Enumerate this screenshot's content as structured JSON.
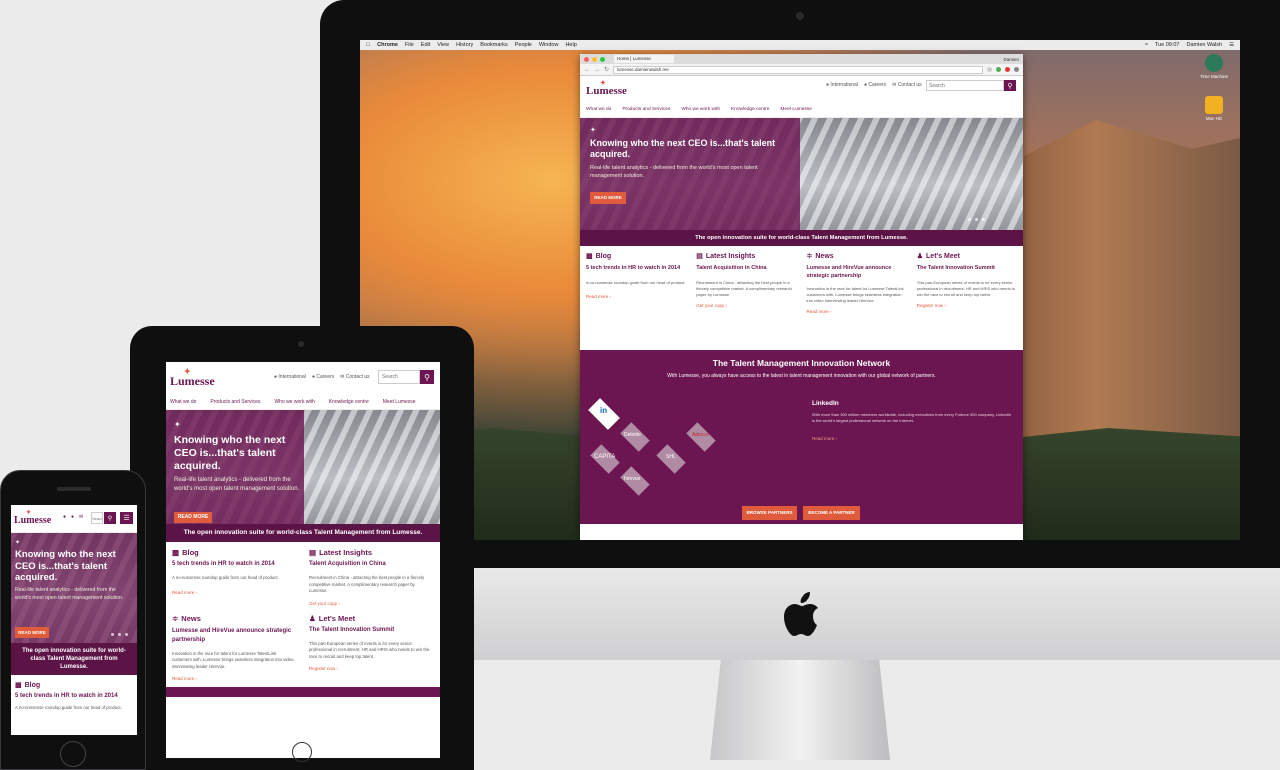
{
  "site": {
    "logo": "Lumesse",
    "utility": {
      "international": "International",
      "careers": "Careers",
      "contact": "Contact us"
    },
    "search_placeholder": "Search",
    "nav": [
      "What we do",
      "Products and Services",
      "Who we work with",
      "Knowledge centre",
      "Meet Lumesse"
    ],
    "hero": {
      "title": "Knowing who the next CEO is...that's talent acquired.",
      "subtitle": "Real-life talent analytics - delivered from the world's most open talent management solution.",
      "cta": "READ MORE"
    },
    "tagline": "The open innovation suite for world-class Talent Management from Lumesse.",
    "columns": [
      {
        "heading": "Blog",
        "title": "5 tech trends in HR to watch in 2014",
        "text": "A no-nonsense roundup guide from our head of product.",
        "link": "Read more ›"
      },
      {
        "heading": "Latest Insights",
        "title": "Talent Acquisition in China",
        "text": "Recruitment in China - attracting the best people in a fiercely competitive market. A complimentary research paper by Lumesse.",
        "link": "Get your copy ›"
      },
      {
        "heading": "News",
        "title": "Lumesse and HireVue announce strategic partnership",
        "text": "Innovation in the race for talent for Lumesse TalentLink customers with, Lumesse brings seamless integration into video interviewing leader HireVue.",
        "link": "Read more ›"
      },
      {
        "heading": "Let's Meet",
        "title": "The Talent Innovation Summit",
        "text": "This pan-European series of events is for every senior professional in recruitment, HR and HRIS who needs to win the race to recruit and keep top talent.",
        "link": "Register now ›"
      }
    ],
    "network": {
      "title": "The Talent Management Innovation Network",
      "intro": "With Lumesse, you always have access to the latest in talent management innovation with our global network of partners.",
      "partners": [
        "in",
        "Deloitte",
        "Adecco",
        "CAPITA",
        "SHL",
        "hirevue"
      ],
      "featured_partner": "LinkedIn",
      "featured_text": "With more than 300 million members worldwide, including executives from every Fortune 500 company, LinkedIn is the world's largest professional network on the Internet.",
      "featured_link": "Read more ›",
      "btn_browse": "BROWSE PARTNERS",
      "btn_become": "BECOME A PARTNER"
    }
  },
  "desktop": {
    "menubar": [
      "Chrome",
      "File",
      "Edit",
      "View",
      "History",
      "Bookmarks",
      "People",
      "Window",
      "Help"
    ],
    "clock": "Tue 09:07",
    "user": "Damien Walsh",
    "tab_title": "Home | Lumesse",
    "browser_user": "Damien",
    "url": "lumesse.damienwalsh.me",
    "desk_icons": [
      "Time Machine",
      "Mac-HD"
    ]
  },
  "colors": {
    "brand": "#6b1651",
    "accent": "#e05a3c"
  }
}
